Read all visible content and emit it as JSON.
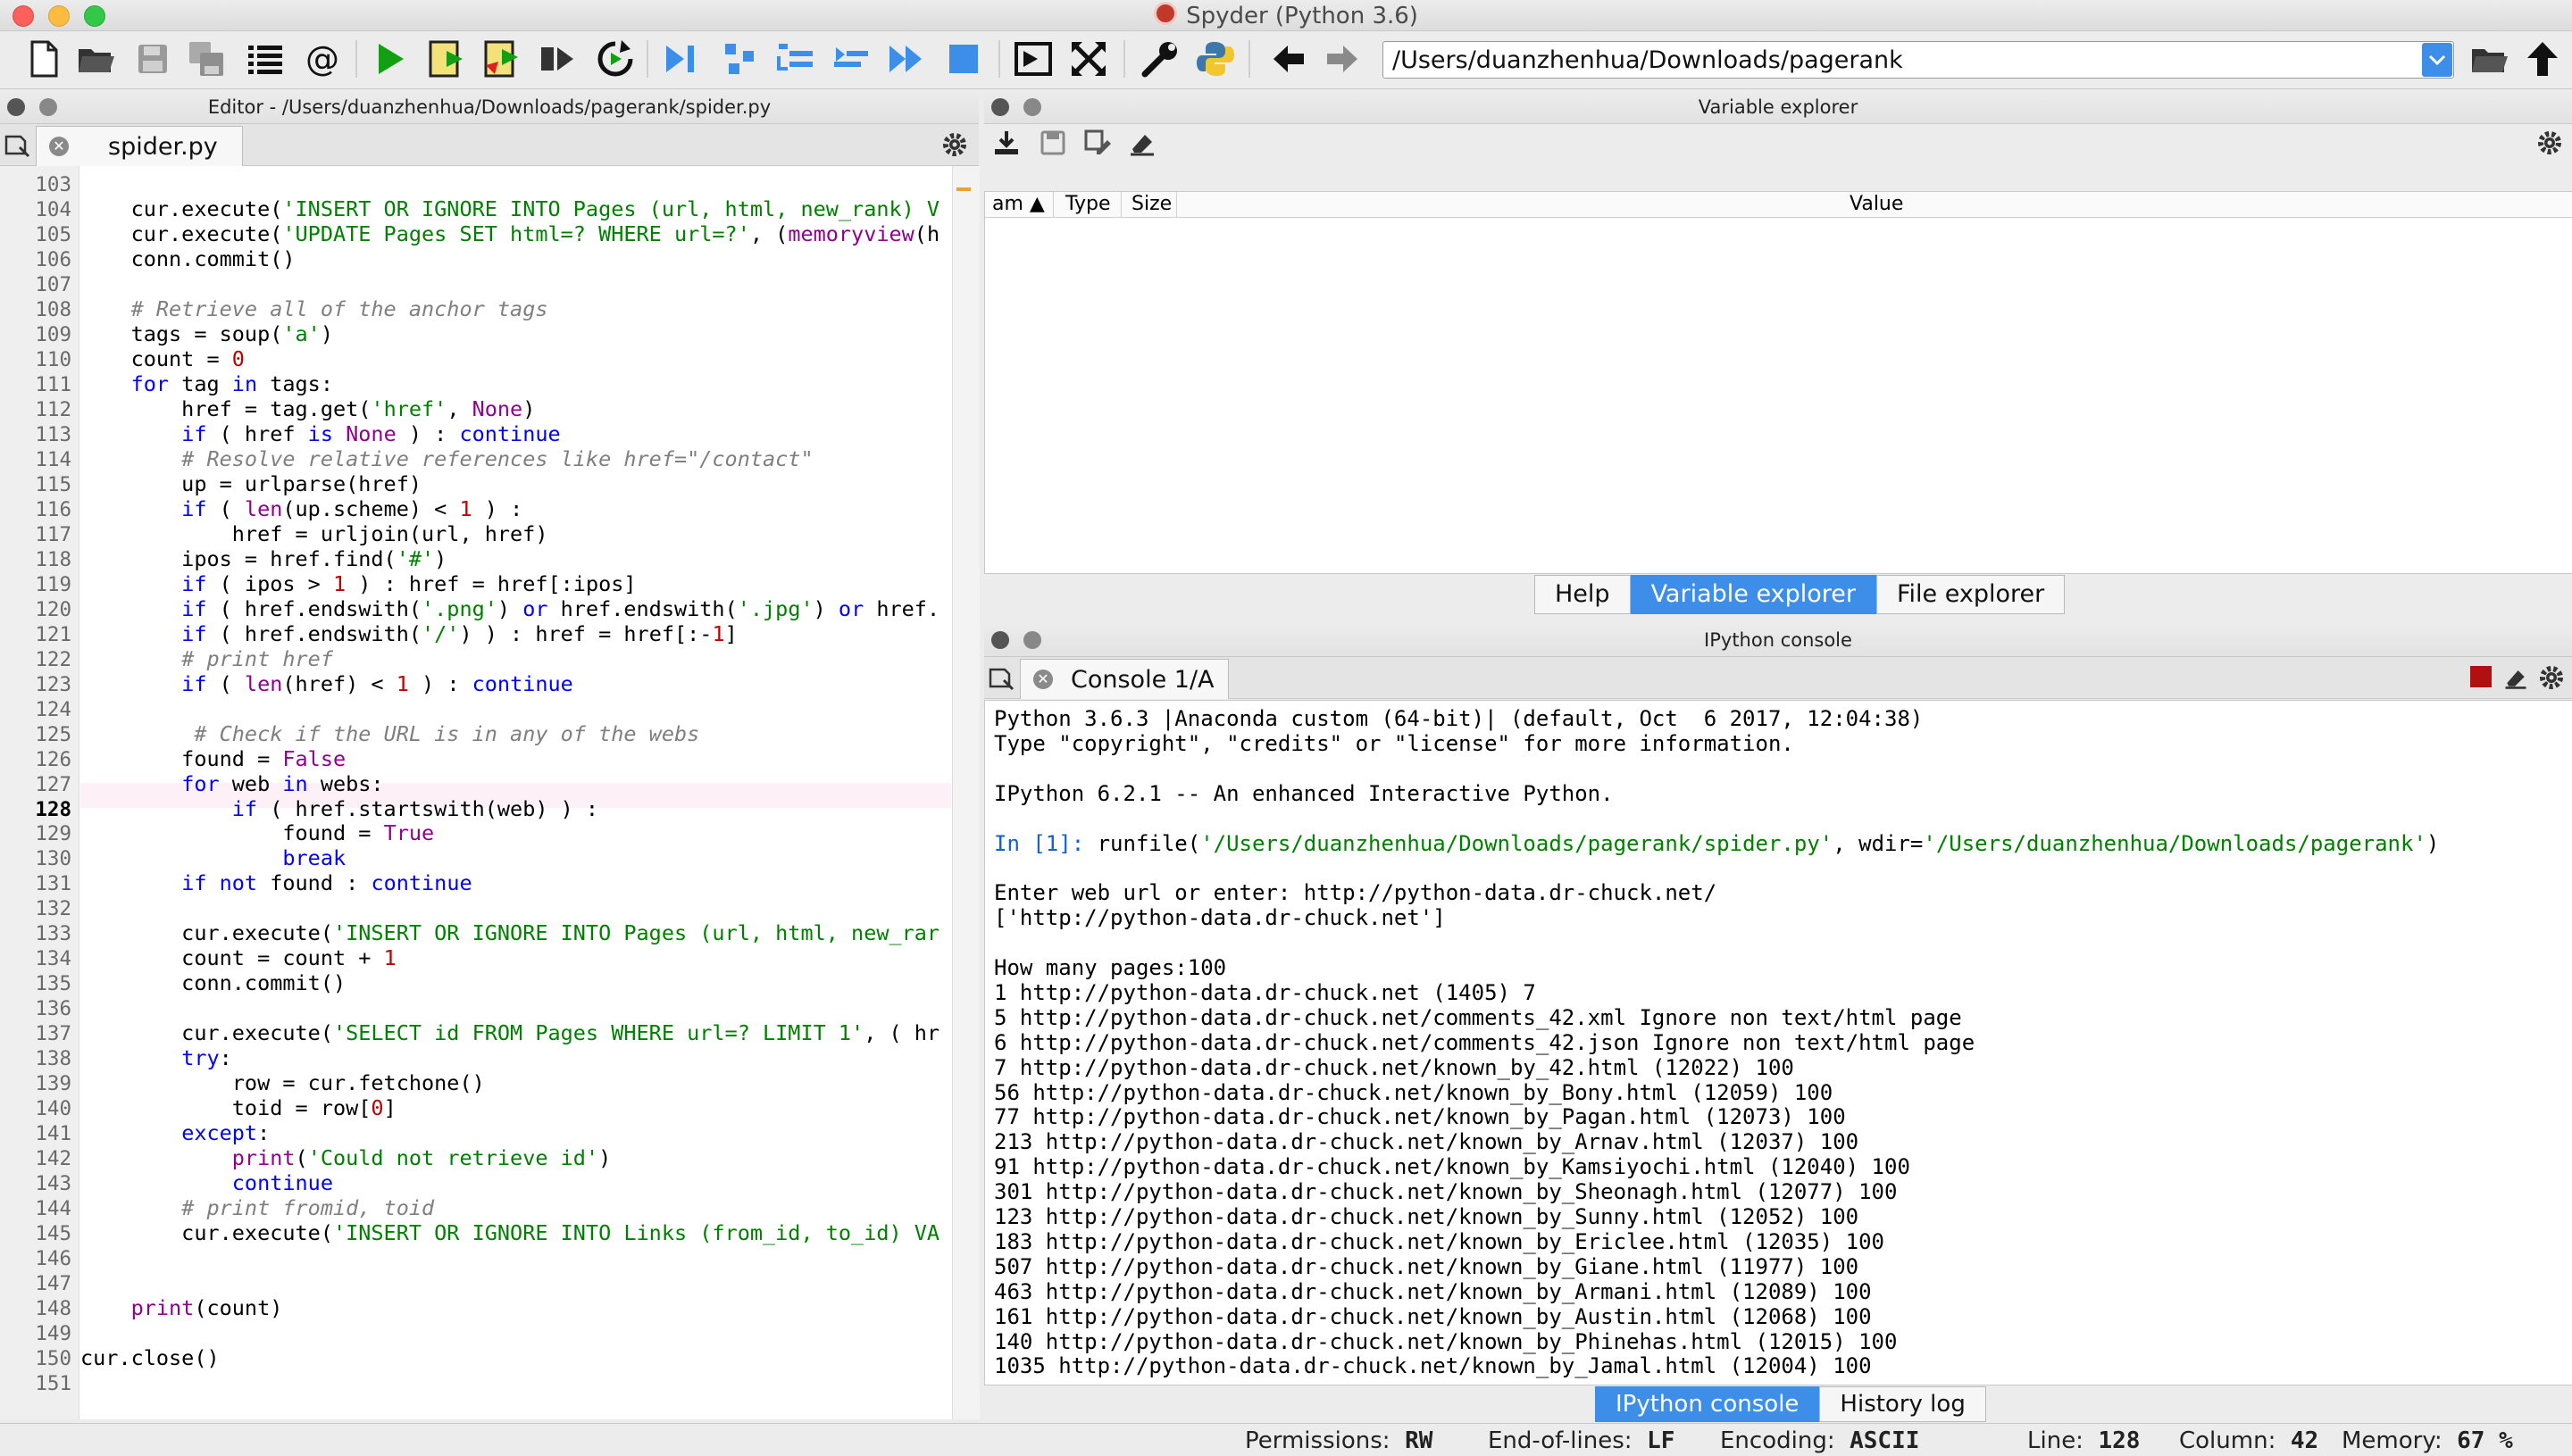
{
  "window": {
    "title": "Spyder (Python 3.6)"
  },
  "toolbar": {
    "path": "/Users/duanzhenhua/Downloads/pagerank",
    "buttons": [
      "new-file",
      "open-file",
      "save-file",
      "save-all",
      "list",
      "at-sign",
      "run",
      "run-cell",
      "run-cell-advance",
      "run-selection",
      "rerun",
      "debug",
      "step",
      "step-into",
      "step-return",
      "continue",
      "stop",
      "maximize",
      "fullscreen",
      "preferences",
      "python-path",
      "back",
      "forward"
    ]
  },
  "editor": {
    "header": "Editor - /Users/duanzhenhua/Downloads/pagerank/spider.py",
    "tab": "spider.py",
    "current_line": 128,
    "lines": [
      {
        "n": "103",
        "code": ""
      },
      {
        "n": "104",
        "code": "    cur.execute('INSERT OR IGNORE INTO Pages (url, html, new_rank) V"
      },
      {
        "n": "105",
        "code": "    cur.execute('UPDATE Pages SET html=? WHERE url=?', (memoryview(h"
      },
      {
        "n": "106",
        "code": "    conn.commit()"
      },
      {
        "n": "107",
        "code": ""
      },
      {
        "n": "108",
        "code": "    # Retrieve all of the anchor tags"
      },
      {
        "n": "109",
        "code": "    tags = soup('a')"
      },
      {
        "n": "110",
        "code": "    count = 0"
      },
      {
        "n": "111",
        "code": "    for tag in tags:"
      },
      {
        "n": "112",
        "code": "        href = tag.get('href', None)"
      },
      {
        "n": "113",
        "code": "        if ( href is None ) : continue"
      },
      {
        "n": "114",
        "code": "        # Resolve relative references like href=\"/contact\""
      },
      {
        "n": "115",
        "code": "        up = urlparse(href)"
      },
      {
        "n": "116",
        "code": "        if ( len(up.scheme) < 1 ) :"
      },
      {
        "n": "117",
        "code": "            href = urljoin(url, href)"
      },
      {
        "n": "118",
        "code": "        ipos = href.find('#')"
      },
      {
        "n": "119",
        "code": "        if ( ipos > 1 ) : href = href[:ipos]"
      },
      {
        "n": "120",
        "code": "        if ( href.endswith('.png') or href.endswith('.jpg') or href."
      },
      {
        "n": "121",
        "code": "        if ( href.endswith('/') ) : href = href[:-1]"
      },
      {
        "n": "122",
        "code": "        # print href"
      },
      {
        "n": "123",
        "code": "        if ( len(href) < 1 ) : continue"
      },
      {
        "n": "124",
        "code": ""
      },
      {
        "n": "125",
        "code": "         # Check if the URL is in any of the webs"
      },
      {
        "n": "126",
        "code": "        found = False"
      },
      {
        "n": "127",
        "code": "        for web in webs:"
      },
      {
        "n": "128",
        "code": "            if ( href.startswith(web) ) :"
      },
      {
        "n": "129",
        "code": "                found = True"
      },
      {
        "n": "130",
        "code": "                break"
      },
      {
        "n": "131",
        "code": "        if not found : continue"
      },
      {
        "n": "132",
        "code": ""
      },
      {
        "n": "133",
        "code": "        cur.execute('INSERT OR IGNORE INTO Pages (url, html, new_rar"
      },
      {
        "n": "134",
        "code": "        count = count + 1"
      },
      {
        "n": "135",
        "code": "        conn.commit()"
      },
      {
        "n": "136",
        "code": ""
      },
      {
        "n": "137",
        "code": "        cur.execute('SELECT id FROM Pages WHERE url=? LIMIT 1', ( hr"
      },
      {
        "n": "138",
        "code": "        try:"
      },
      {
        "n": "139",
        "code": "            row = cur.fetchone()"
      },
      {
        "n": "140",
        "code": "            toid = row[0]"
      },
      {
        "n": "141",
        "code": "        except:"
      },
      {
        "n": "142",
        "code": "            print('Could not retrieve id')"
      },
      {
        "n": "143",
        "code": "            continue"
      },
      {
        "n": "144",
        "code": "        # print fromid, toid"
      },
      {
        "n": "145",
        "code": "        cur.execute('INSERT OR IGNORE INTO Links (from_id, to_id) VA"
      },
      {
        "n": "146",
        "code": ""
      },
      {
        "n": "147",
        "code": ""
      },
      {
        "n": "148",
        "code": "    print(count)"
      },
      {
        "n": "149",
        "code": ""
      },
      {
        "n": "150",
        "code": "cur.close()"
      },
      {
        "n": "151",
        "code": ""
      }
    ]
  },
  "variable_explorer": {
    "header": "Variable explorer",
    "columns": [
      "am",
      "Type",
      "Size",
      "Value"
    ],
    "tabs": [
      "Help",
      "Variable explorer",
      "File explorer"
    ],
    "active_tab": "Variable explorer"
  },
  "console": {
    "header": "IPython console",
    "tab": "Console 1/A",
    "lines": [
      {
        "t": "Python 3.6.3 |Anaconda custom (64-bit)| (default, Oct  6 2017, 12:04:38)"
      },
      {
        "t": "Type \"copyright\", \"credits\" or \"license\" for more information."
      },
      {
        "t": ""
      },
      {
        "t": "IPython 6.2.1 -- An enhanced Interactive Python."
      },
      {
        "t": ""
      },
      {
        "t": "In [1]: runfile('/Users/duanzhenhua/Downloads/pagerank/spider.py', wdir='/Users/duanzhenhua/Downloads/pagerank')",
        "prompt": true
      },
      {
        "t": ""
      },
      {
        "t": "Enter web url or enter: http://python-data.dr-chuck.net/"
      },
      {
        "t": "['http://python-data.dr-chuck.net']"
      },
      {
        "t": ""
      },
      {
        "t": "How many pages:100"
      },
      {
        "t": "1 http://python-data.dr-chuck.net (1405) 7"
      },
      {
        "t": "5 http://python-data.dr-chuck.net/comments_42.xml Ignore non text/html page"
      },
      {
        "t": "6 http://python-data.dr-chuck.net/comments_42.json Ignore non text/html page"
      },
      {
        "t": "7 http://python-data.dr-chuck.net/known_by_42.html (12022) 100"
      },
      {
        "t": "56 http://python-data.dr-chuck.net/known_by_Bony.html (12059) 100"
      },
      {
        "t": "77 http://python-data.dr-chuck.net/known_by_Pagan.html (12073) 100"
      },
      {
        "t": "213 http://python-data.dr-chuck.net/known_by_Arnav.html (12037) 100"
      },
      {
        "t": "91 http://python-data.dr-chuck.net/known_by_Kamsiyochi.html (12040) 100"
      },
      {
        "t": "301 http://python-data.dr-chuck.net/known_by_Sheonagh.html (12077) 100"
      },
      {
        "t": "123 http://python-data.dr-chuck.net/known_by_Sunny.html (12052) 100"
      },
      {
        "t": "183 http://python-data.dr-chuck.net/known_by_Ericlee.html (12035) 100"
      },
      {
        "t": "507 http://python-data.dr-chuck.net/known_by_Giane.html (11977) 100"
      },
      {
        "t": "463 http://python-data.dr-chuck.net/known_by_Armani.html (12089) 100"
      },
      {
        "t": "161 http://python-data.dr-chuck.net/known_by_Austin.html (12068) 100"
      },
      {
        "t": "140 http://python-data.dr-chuck.net/known_by_Phinehas.html (12015) 100"
      },
      {
        "t": "1035 http://python-data.dr-chuck.net/known_by_Jamal.html (12004) 100"
      }
    ],
    "tabs": [
      "IPython console",
      "History log"
    ],
    "active_tab": "IPython console"
  },
  "statusbar": {
    "permissions_label": "Permissions:",
    "permissions": "RW",
    "eol_label": "End-of-lines:",
    "eol": "LF",
    "encoding_label": "Encoding:",
    "encoding": "ASCII",
    "line_label": "Line:",
    "line": "128",
    "column_label": "Column:",
    "column": "42",
    "memory_label": "Memory:",
    "memory": "67 %"
  },
  "colors": {
    "accent": "#3d8ee8",
    "keyword": "#0000ff",
    "string": "#008000",
    "comment": "#7f7f7f",
    "builtin": "#900090",
    "number": "#c00000",
    "current_line_bg": "#fdf0f7"
  }
}
